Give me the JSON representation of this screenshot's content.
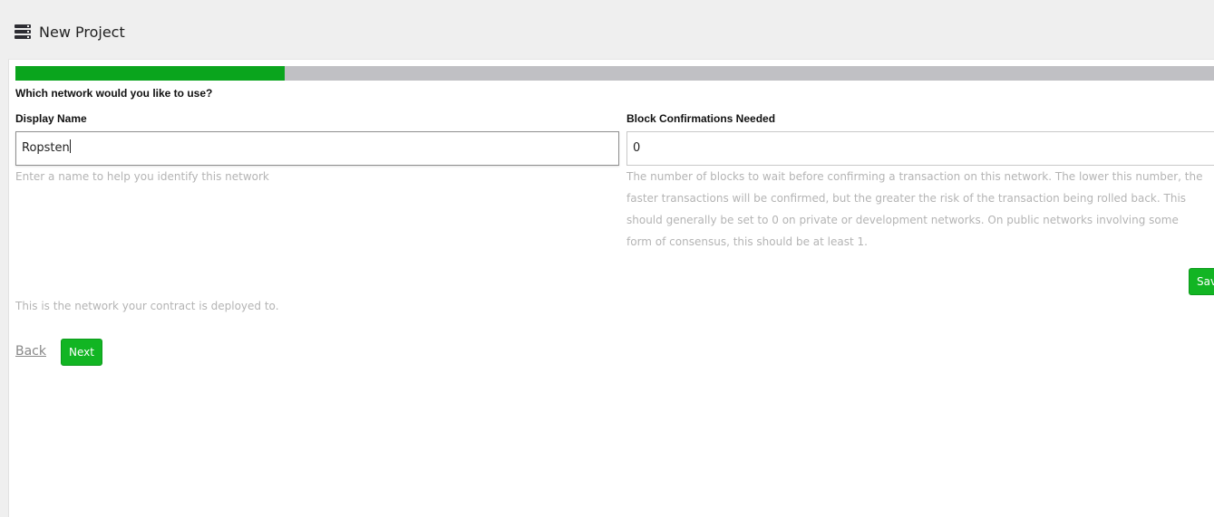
{
  "header": {
    "title": "New Project",
    "icon": "server-stack-icon"
  },
  "progress": {
    "fraction": 0.225,
    "fill_color": "#0aa51d",
    "track_color": "#c0c0c4"
  },
  "question": "Which network would you like to use?",
  "display_name": {
    "label": "Display Name",
    "value": "Ropsten",
    "help": "Enter a name to help you identify this network"
  },
  "block_confirmations": {
    "label": "Block Confirmations Needed",
    "value": "0",
    "help": "The number of blocks to wait before confirming a transaction on this network. The lower this number, the faster transactions will be confirmed, but the greater the risk of the transaction being rolled back. This should generally be set to 0 on private or development networks. On public networks involving some form of consensus, this should be at least 1."
  },
  "save_button": {
    "label": "Save"
  },
  "network_help": "This is the network your contract is deployed to.",
  "nav": {
    "back_label": "Back",
    "next_label": "Next"
  },
  "colors": {
    "accent": "#12b523",
    "help_text": "#b4b4b4"
  }
}
